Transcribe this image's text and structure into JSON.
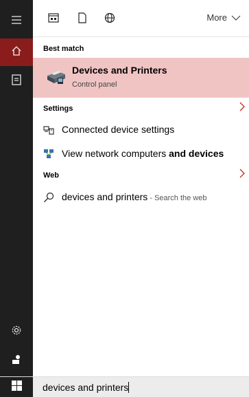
{
  "colors": {
    "rail_bg": "#1f1f1f",
    "active_rail": "#8b1c1c",
    "best_match_bg": "#f1c4c4",
    "chevron": "#c42b1c"
  },
  "rail": {
    "hamburger_icon": "hamburger-icon",
    "home_icon": "home-icon",
    "documents_icon": "documents-icon",
    "settings_icon": "gear-icon",
    "user_icon": "user-icon"
  },
  "topbar": {
    "filters": [
      "apps-filter-icon",
      "documents-filter-icon",
      "web-filter-icon"
    ],
    "more_label": "More"
  },
  "results": {
    "best_match_header": "Best match",
    "best_match": {
      "title": "Devices and Printers",
      "subtitle": "Control panel",
      "icon": "printer-icon"
    },
    "settings_header": "Settings",
    "settings_items": [
      {
        "label": "Connected device settings",
        "icon": "connected-devices-icon"
      },
      {
        "label_prefix": "View network computers ",
        "label_bold": "and devices",
        "icon": "network-icon"
      }
    ],
    "web_header": "Web",
    "web_items": [
      {
        "label": "devices and printers",
        "suffix": " - Search the web",
        "icon": "search-icon"
      }
    ]
  },
  "taskbar": {
    "start_icon": "windows-logo-icon",
    "search_value": "devices and printers"
  }
}
